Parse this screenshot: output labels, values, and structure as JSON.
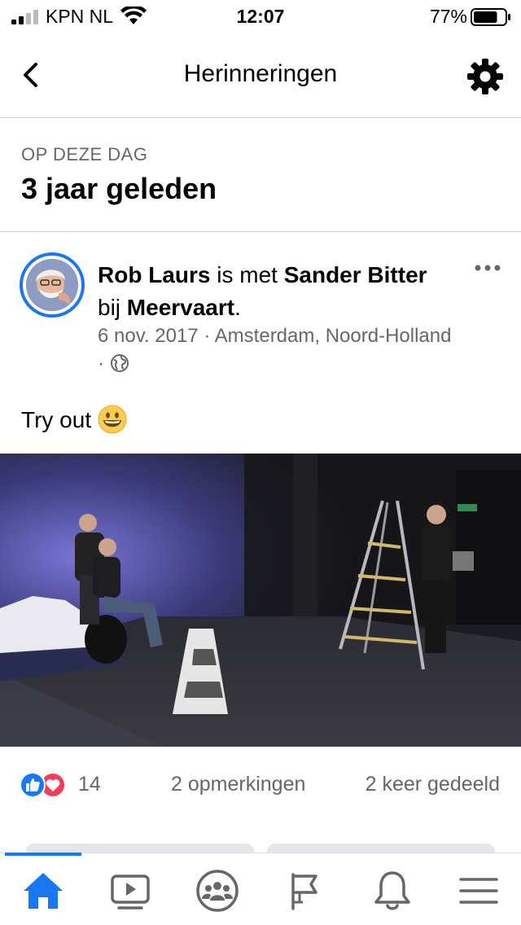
{
  "status_bar": {
    "carrier": "KPN NL",
    "time": "12:07",
    "battery_percent": "77%",
    "battery_level": 0.77
  },
  "nav": {
    "title": "Herinneringen"
  },
  "memory": {
    "subtitle": "OP DEZE DAG",
    "headline": "3 jaar geleden"
  },
  "post": {
    "author": "Rob Laurs",
    "with_word": "is met",
    "tagged": "Sander Bitter",
    "at_word": "bij",
    "place": "Meervaart",
    "place_suffix": ".",
    "date": "6 nov. 2017",
    "location": "Amsterdam, Noord-Holland",
    "separator": "·",
    "text": "Try out",
    "reaction_count": "14",
    "comments": "2 opmerkingen",
    "shares": "2 keer gedeeld"
  },
  "colors": {
    "accent": "#1877f2",
    "love": "#f33e58",
    "secondary_text": "#65676b"
  },
  "icons": {
    "back": "chevron-left-icon",
    "settings": "gear-icon",
    "privacy": "globe-icon",
    "tabs": [
      "home-icon",
      "video-icon",
      "groups-icon",
      "pages-icon",
      "bell-icon",
      "menu-icon"
    ]
  }
}
